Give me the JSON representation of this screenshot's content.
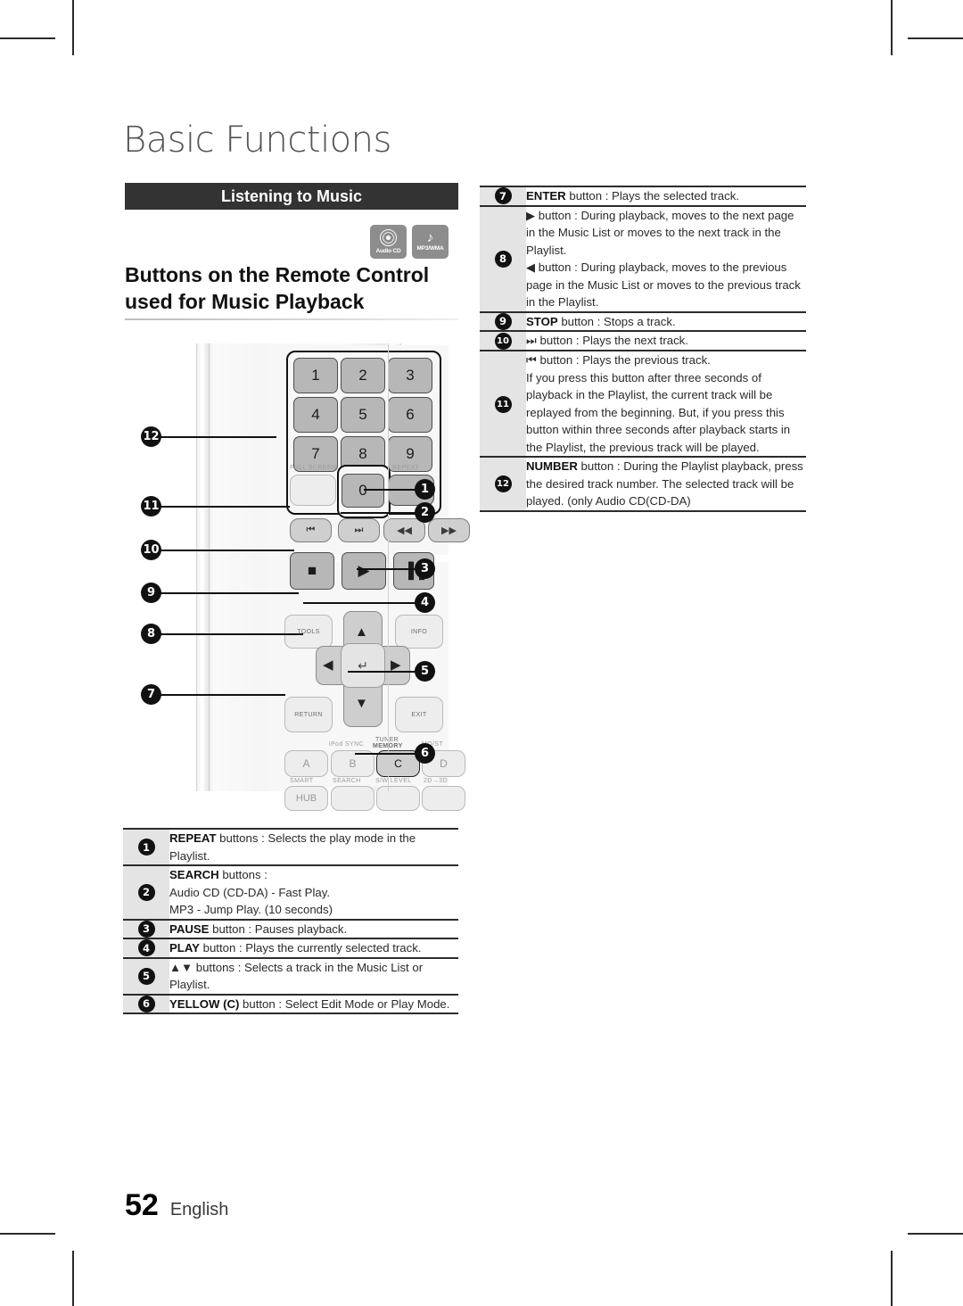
{
  "chapter": {
    "title": "Basic Functions"
  },
  "section": {
    "bar_label": "Listening to Music"
  },
  "badges": [
    {
      "name": "audio-cd",
      "caption": "Audio CD",
      "glyph": "disc"
    },
    {
      "name": "mp3-wma",
      "caption": "MP3/WMA",
      "glyph": "♪"
    }
  ],
  "heading": {
    "line1": "Buttons on the Remote Control",
    "line2": "used for Music Playback"
  },
  "remote": {
    "keys": {
      "n1": "1",
      "n2": "2",
      "n3": "3",
      "n4": "4",
      "n5": "5",
      "n6": "6",
      "n7": "7",
      "n8": "8",
      "n9": "9",
      "n0": "0",
      "full_screen": "FULL SCREEN",
      "repeat": "REPEAT",
      "prev": "⏮",
      "next": "⏭",
      "rew": "◀◀",
      "ff": "▶▶",
      "stop": "■",
      "play": "▶",
      "pause": "▐▐",
      "tools": "TOOLS",
      "info": "INFO",
      "return": "RETURN",
      "exit": "EXIT",
      "up": "▲",
      "down": "▼",
      "left": "◀",
      "right": "▶",
      "enter": "↵",
      "a": "A",
      "b": "B",
      "c": "C",
      "d": "D",
      "ipod_sync": "iPod SYNC",
      "tuner": "TUNER",
      "memory": "MEMORY",
      "most": "MO/ST",
      "smart": "SMART",
      "hub": "HUB",
      "search": "SEARCH",
      "sw_level": "S/W LEVEL",
      "two_d_three_d": "2D→3D"
    },
    "callouts_left": [
      "12",
      "11",
      "10",
      "9",
      "8",
      "7"
    ],
    "callouts_right": [
      "1",
      "2",
      "3",
      "4",
      "5",
      "6"
    ]
  },
  "table_right": {
    "rows": [
      {
        "num": "7",
        "lines": [
          {
            "bold": "ENTER",
            "rest": " button : Plays the selected track."
          }
        ]
      },
      {
        "num": "8",
        "lines": [
          {
            "bold": "",
            "rest": "▶ button : During playback, moves to the next page in the Music List or moves to the next track in the Playlist."
          },
          {
            "bold": "",
            "rest": "◀ button : During playback, moves to the previous page in the Music List or moves to the previous track in the Playlist."
          }
        ]
      },
      {
        "num": "9",
        "lines": [
          {
            "bold": "STOP",
            "rest": " button : Stops a track."
          }
        ]
      },
      {
        "num": "10",
        "lines": [
          {
            "bold": "",
            "rest": "⏭ button : Plays the next track."
          }
        ]
      },
      {
        "num": "11",
        "lines": [
          {
            "bold": "",
            "rest": "⏮ button : Plays the previous track."
          },
          {
            "bold": "",
            "rest": "If you press this button after three seconds of playback in the Playlist, the current track will be replayed from the beginning. But, if you press this button within three seconds after playback starts in the Playlist, the previous track will be played."
          }
        ]
      },
      {
        "num": "12",
        "lines": [
          {
            "bold": "NUMBER",
            "rest": " button : During the Playlist playback, press the desired track number. The selected track will be played. (only Audio CD(CD-DA)"
          }
        ]
      }
    ]
  },
  "table_left": {
    "rows": [
      {
        "num": "1",
        "lines": [
          {
            "bold": "REPEAT",
            "rest": " buttons : Selects the play mode in the Playlist."
          }
        ]
      },
      {
        "num": "2",
        "lines": [
          {
            "bold": "SEARCH",
            "rest": " buttons :"
          },
          {
            "bold": "",
            "rest": "Audio CD (CD-DA) - Fast Play."
          },
          {
            "bold": "",
            "rest": "MP3 - Jump Play. (10 seconds)"
          }
        ]
      },
      {
        "num": "3",
        "lines": [
          {
            "bold": "PAUSE",
            "rest": " button : Pauses playback."
          }
        ]
      },
      {
        "num": "4",
        "lines": [
          {
            "bold": "PLAY",
            "rest": " button : Plays the currently selected track."
          }
        ]
      },
      {
        "num": "5",
        "lines": [
          {
            "bold": "",
            "rest": "▲▼ buttons : Selects a track in the Music List or Playlist."
          }
        ]
      },
      {
        "num": "6",
        "lines": [
          {
            "bold": "YELLOW (C)",
            "rest": " button : Select Edit Mode or Play Mode."
          }
        ]
      }
    ]
  },
  "footer": {
    "page": "52",
    "language": "English"
  }
}
